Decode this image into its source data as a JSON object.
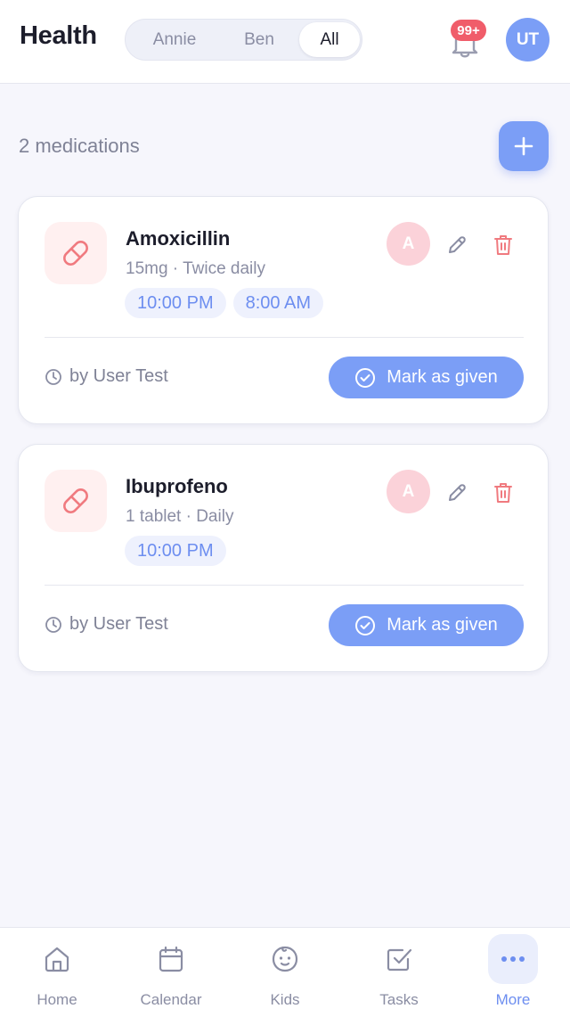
{
  "header": {
    "title": "Health",
    "tabs": [
      {
        "label": "Annie",
        "active": false
      },
      {
        "label": "Ben",
        "active": false
      },
      {
        "label": "All",
        "active": true
      }
    ],
    "notification_badge": "99+",
    "user_initials": "UT",
    "accent_color": "#7b9ef6"
  },
  "summary": {
    "count_label": "2 medications",
    "add_icon": "plus-icon"
  },
  "medications": [
    {
      "name": "Amoxicillin",
      "dose": "15mg · Twice daily",
      "times": [
        "10:00 PM",
        "8:00 AM"
      ],
      "person_initial": "A",
      "by": "by User Test",
      "action": "Mark as given"
    },
    {
      "name": "Ibuprofeno",
      "dose": "1 tablet · Daily",
      "times": [
        "10:00 PM"
      ],
      "person_initial": "A",
      "by": "by User Test",
      "action": "Mark as given"
    }
  ],
  "bottom_nav": [
    {
      "label": "Home",
      "icon": "home-icon",
      "active": false
    },
    {
      "label": "Calendar",
      "icon": "calendar-icon",
      "active": false
    },
    {
      "label": "Kids",
      "icon": "baby-face-icon",
      "active": false
    },
    {
      "label": "Tasks",
      "icon": "checkbox-icon",
      "active": false
    },
    {
      "label": "More",
      "icon": "more-dots-icon",
      "active": true
    }
  ]
}
